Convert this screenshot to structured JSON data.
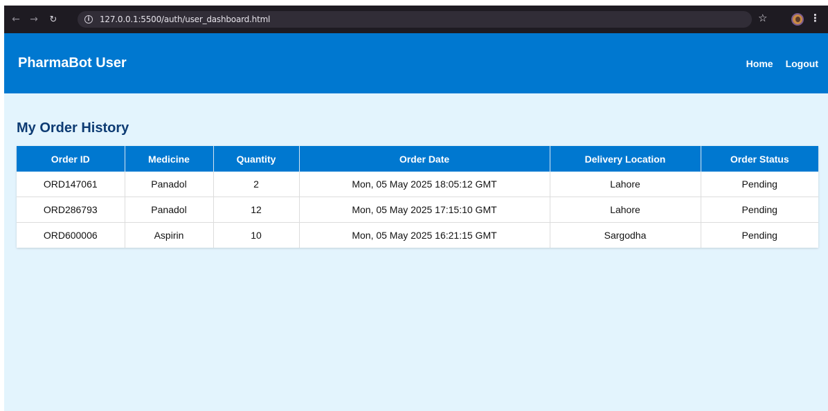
{
  "browser": {
    "url": "127.0.0.1:5500/auth/user_dashboard.html"
  },
  "header": {
    "title": "PharmaBot User",
    "nav": {
      "home": "Home",
      "logout": "Logout"
    }
  },
  "main": {
    "title": "My Order History",
    "columns": [
      "Order ID",
      "Medicine",
      "Quantity",
      "Order Date",
      "Delivery Location",
      "Order Status"
    ],
    "rows": [
      {
        "order_id": "ORD147061",
        "medicine": "Panadol",
        "quantity": "2",
        "order_date": "Mon, 05 May 2025 18:05:12 GMT",
        "location": "Lahore",
        "status": "Pending"
      },
      {
        "order_id": "ORD286793",
        "medicine": "Panadol",
        "quantity": "12",
        "order_date": "Mon, 05 May 2025 17:15:10 GMT",
        "location": "Lahore",
        "status": "Pending"
      },
      {
        "order_id": "ORD600006",
        "medicine": "Aspirin",
        "quantity": "10",
        "order_date": "Mon, 05 May 2025 16:21:15 GMT",
        "location": "Sargodha",
        "status": "Pending"
      }
    ]
  },
  "colors": {
    "brand": "#0078d0",
    "page_bg": "#e3f4fd",
    "title": "#0d3b73"
  },
  "icons": {
    "back": "arrow-left-icon",
    "forward": "arrow-right-icon",
    "reload": "reload-icon",
    "info": "info-icon",
    "bookmark": "star-icon",
    "profile": "profile-icon",
    "menu": "kebab-menu-icon"
  }
}
